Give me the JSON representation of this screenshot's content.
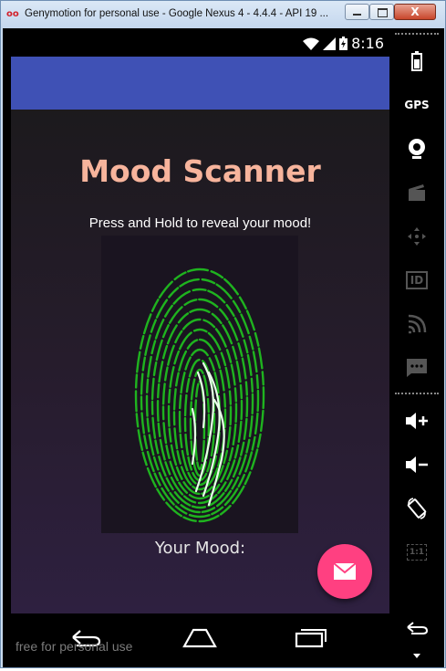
{
  "window": {
    "title": "Genymotion for personal use - Google Nexus 4 - 4.4.4 - API 19 ...",
    "close_label": "X"
  },
  "statusbar": {
    "time": "8:16"
  },
  "app": {
    "headline": "Mood Scanner",
    "instructions": "Press and Hold to reveal your mood!",
    "mood_label": "Your Mood:"
  },
  "watermark": "free for personal use",
  "sidebar": {
    "items": [
      {
        "icon": "battery-icon",
        "label": ""
      },
      {
        "icon": "gps-icon",
        "label": "GPS"
      },
      {
        "icon": "camera-icon",
        "label": ""
      },
      {
        "icon": "capture-icon",
        "label": ""
      },
      {
        "icon": "dpad-icon",
        "label": ""
      },
      {
        "icon": "id-icon",
        "label": "ID"
      },
      {
        "icon": "cast-icon",
        "label": ""
      },
      {
        "icon": "sms-icon",
        "label": ""
      },
      {
        "icon": "volume-up-icon",
        "label": ""
      },
      {
        "icon": "volume-down-icon",
        "label": ""
      },
      {
        "icon": "rotate-icon",
        "label": ""
      },
      {
        "icon": "pixel-perfect-icon",
        "label": "1:1"
      },
      {
        "icon": "back-icon",
        "label": ""
      },
      {
        "icon": "more-icon",
        "label": ""
      }
    ]
  },
  "colors": {
    "toolbar": "#3f51b5",
    "accent": "#ff4081",
    "headline": "#f7b49c",
    "fingerprint": "#1fb31f"
  }
}
